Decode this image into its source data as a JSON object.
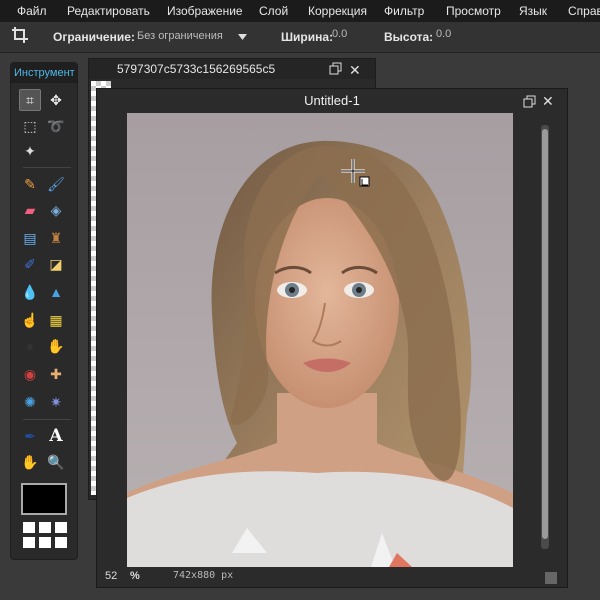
{
  "menubar": {
    "items": [
      "Файл",
      "Редактировать",
      "Изображение",
      "Слой",
      "Коррекция",
      "Фильтр",
      "Просмотр",
      "Язык",
      "Справ"
    ]
  },
  "options": {
    "constraint_label": "Ограничение:",
    "constraint_value": "Без ограничения",
    "width_label": "Ширина:",
    "width_value": "0.0",
    "height_label": "Высота:",
    "height_value": "0.0"
  },
  "toolbox": {
    "title": "Инструмент",
    "tools": [
      {
        "name": "crop-tool-icon",
        "glyph": "⌗",
        "active": true
      },
      {
        "name": "move-tool-icon",
        "glyph": "✥"
      },
      {
        "name": "marquee-tool-icon",
        "glyph": "⬚"
      },
      {
        "name": "lasso-tool-icon",
        "glyph": "➰"
      },
      {
        "name": "magic-wand-tool-icon",
        "glyph": "✦"
      },
      {
        "name": "pencil-tool-icon",
        "glyph": "✎"
      },
      {
        "name": "brush-tool-icon",
        "glyph": "🖌"
      },
      {
        "name": "eraser-tool-icon",
        "glyph": "▰"
      },
      {
        "name": "paint-bucket-tool-icon",
        "glyph": "◈"
      },
      {
        "name": "gradient-tool-icon",
        "glyph": "▤"
      },
      {
        "name": "clone-stamp-tool-icon",
        "glyph": "♜"
      },
      {
        "name": "color-replace-tool-icon",
        "glyph": "✐"
      },
      {
        "name": "draw-shape-tool-icon",
        "glyph": "◪"
      },
      {
        "name": "blur-tool-icon",
        "glyph": "💧"
      },
      {
        "name": "sharpen-tool-icon",
        "glyph": "▲"
      },
      {
        "name": "smudge-tool-icon",
        "glyph": "☝"
      },
      {
        "name": "sponge-tool-icon",
        "glyph": "▦"
      },
      {
        "name": "dodge-tool-icon",
        "glyph": "●"
      },
      {
        "name": "burn-tool-icon",
        "glyph": "✋"
      },
      {
        "name": "red-eye-tool-icon",
        "glyph": "◉"
      },
      {
        "name": "spot-heal-tool-icon",
        "glyph": "✚"
      },
      {
        "name": "bloat-tool-icon",
        "glyph": "✺"
      },
      {
        "name": "pinch-tool-icon",
        "glyph": "✷"
      },
      {
        "name": "color-picker-tool-icon",
        "glyph": "✒"
      },
      {
        "name": "type-tool-icon",
        "glyph": "A"
      },
      {
        "name": "hand-tool-icon",
        "glyph": "✋"
      },
      {
        "name": "zoom-tool-icon",
        "glyph": "🔍"
      }
    ],
    "foreground_color": "#000000"
  },
  "window_back": {
    "title": "5797307c5733c156269565c5"
  },
  "window_front": {
    "title": "Untitled-1",
    "zoom_value": "52",
    "zoom_unit": "%",
    "dimensions": "742x880 px"
  },
  "colors": {
    "accent": "#4fb8e8",
    "menubar_bg": "#1b1b1b",
    "workspace_bg": "#3a3a3a"
  }
}
